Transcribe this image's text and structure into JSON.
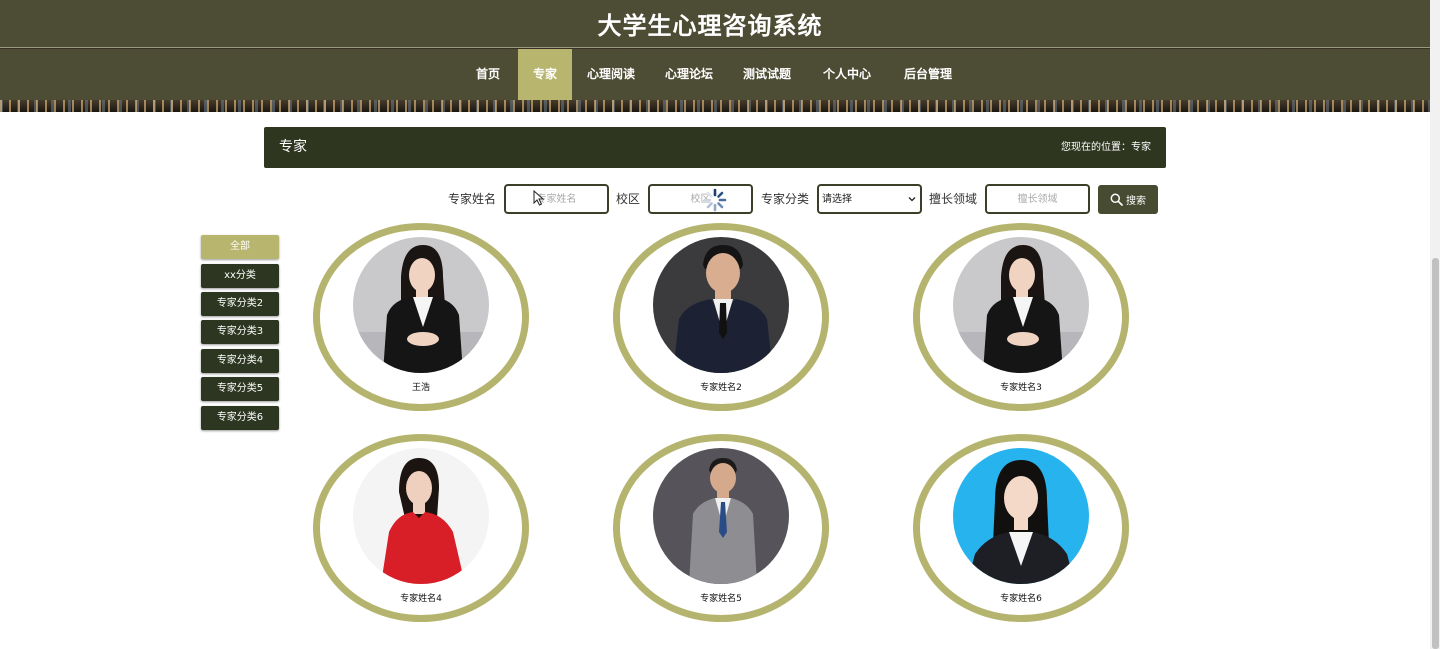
{
  "site": {
    "title": "大学生心理咨询系统"
  },
  "nav": {
    "items": [
      {
        "label": "首页",
        "active": false
      },
      {
        "label": "专家",
        "active": true
      },
      {
        "label": "心理阅读",
        "active": false
      },
      {
        "label": "心理论坛",
        "active": false
      },
      {
        "label": "测试试题",
        "active": false
      },
      {
        "label": "个人中心",
        "active": false
      },
      {
        "label": "后台管理",
        "active": false
      }
    ]
  },
  "breadcrumb": {
    "title": "专家",
    "location": "您现在的位置：专家"
  },
  "search": {
    "name_label": "专家姓名",
    "name_placeholder": "专家姓名",
    "campus_label": "校区",
    "campus_placeholder": "校区",
    "category_label": "专家分类",
    "category_selected": "请选择",
    "field_label": "擅长领域",
    "field_placeholder": "擅长领域",
    "button_label": "搜索"
  },
  "categories": [
    {
      "label": "全部",
      "active": true
    },
    {
      "label": "xx分类",
      "active": false
    },
    {
      "label": "专家分类2",
      "active": false
    },
    {
      "label": "专家分类3",
      "active": false
    },
    {
      "label": "专家分类4",
      "active": false
    },
    {
      "label": "专家分类5",
      "active": false
    },
    {
      "label": "专家分类6",
      "active": false
    }
  ],
  "experts": [
    {
      "name": "王浩",
      "photo": "woman-black-suit-portrait"
    },
    {
      "name": "专家姓名2",
      "photo": "man-navy-suit-portrait"
    },
    {
      "name": "专家姓名3",
      "photo": "woman-black-suit-portrait"
    },
    {
      "name": "专家姓名4",
      "photo": "woman-red-dress-portrait"
    },
    {
      "name": "专家姓名5",
      "photo": "man-grey-suit-portrait"
    },
    {
      "name": "专家姓名6",
      "photo": "woman-blue-background-portrait"
    }
  ],
  "colors": {
    "header_bg": "#4d4c34",
    "accent": "#b8b66e",
    "dark_green": "#2f3620",
    "ring": "#b5b46e"
  }
}
